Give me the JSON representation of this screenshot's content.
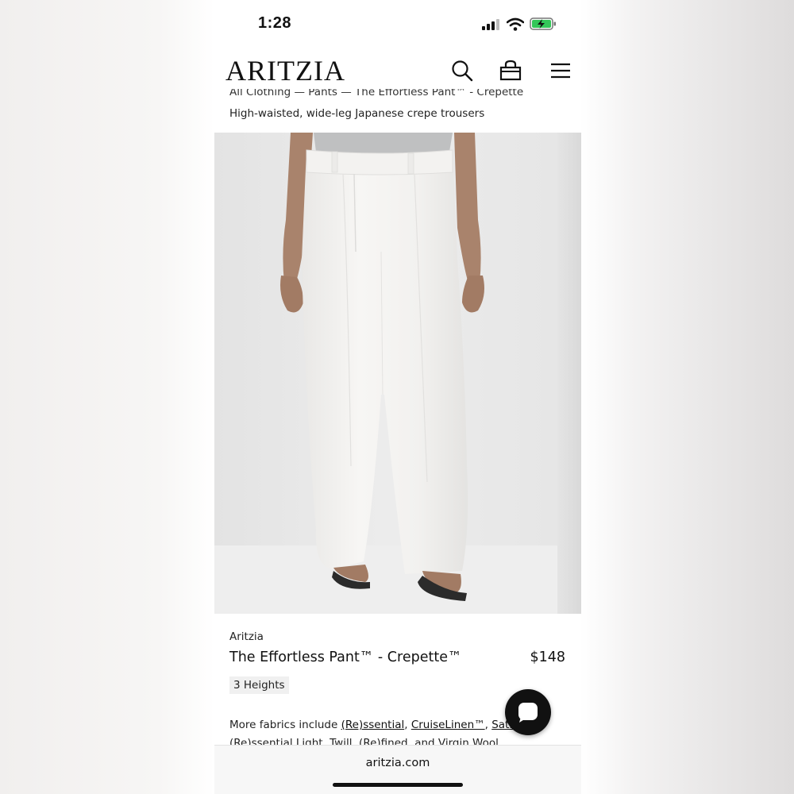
{
  "status_bar": {
    "time": "1:28"
  },
  "header": {
    "logo": "ARITZIA",
    "icons": [
      "search-icon",
      "bag-icon",
      "menu-icon"
    ]
  },
  "breadcrumb": "All Clothing — Pants — The Effortless Pant™ - Crepette",
  "subtitle": "High-waisted, wide-leg Japanese crepe trousers",
  "product": {
    "brand": "Aritzia",
    "name": "The Effortless Pant™ - Crepette™",
    "price": "$148",
    "badge": "3 Heights",
    "fabrics_prefix": "More fabrics include ",
    "fabric_links": [
      "(Re)ssential",
      "CruiseLinen™",
      "Satin"
    ],
    "fabrics_line2": "(Re)ssential Light, Twill, (Re)fined, and Virgin Wool"
  },
  "browser": {
    "url": "aritzia.com"
  },
  "colors": {
    "text": "#111111",
    "battery_charge": "#34c759",
    "page_bg": "#ffffff"
  }
}
